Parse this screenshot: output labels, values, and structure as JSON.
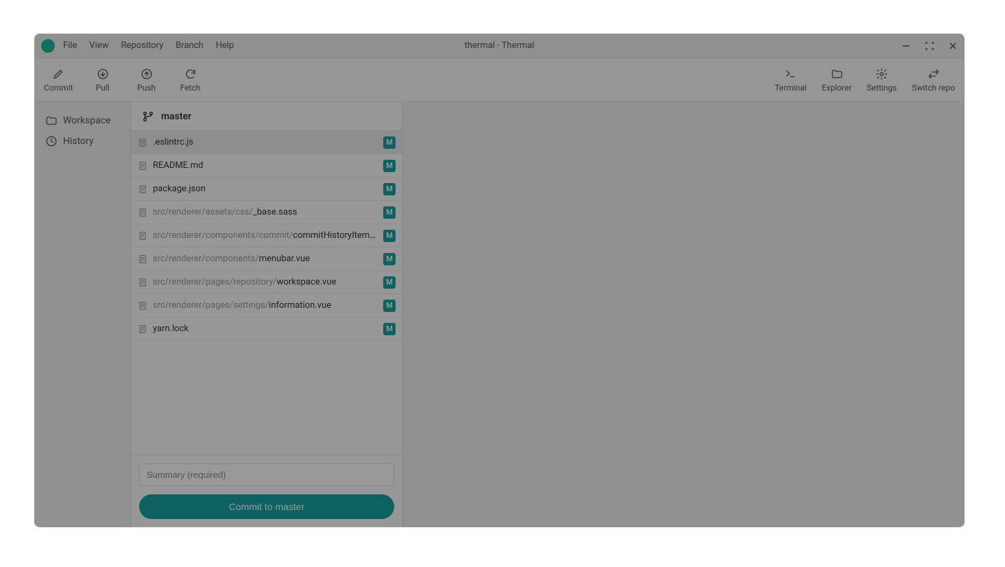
{
  "title": "thermal - Thermal",
  "menu": [
    "File",
    "View",
    "Repository",
    "Branch",
    "Help"
  ],
  "toolbar": {
    "left": [
      {
        "id": "commit",
        "label": "Commit",
        "icon": "pencil"
      },
      {
        "id": "pull",
        "label": "Pull",
        "icon": "arrow-down-circle"
      },
      {
        "id": "push",
        "label": "Push",
        "icon": "arrow-up-circle"
      },
      {
        "id": "fetch",
        "label": "Fetch",
        "icon": "refresh"
      }
    ],
    "right": [
      {
        "id": "terminal",
        "label": "Terminal",
        "icon": "terminal"
      },
      {
        "id": "explorer",
        "label": "Explorer",
        "icon": "folder"
      },
      {
        "id": "settings",
        "label": "Settings",
        "icon": "gear"
      },
      {
        "id": "switch",
        "label": "Switch repo",
        "icon": "swap"
      }
    ]
  },
  "sidebar": [
    {
      "id": "workspace",
      "label": "Workspace",
      "icon": "folder"
    },
    {
      "id": "history",
      "label": "History",
      "icon": "clock"
    }
  ],
  "branch": "master",
  "files": [
    {
      "dir": "",
      "name": ".eslintrc.js",
      "status": "M",
      "selected": true
    },
    {
      "dir": "",
      "name": "README.md",
      "status": "M"
    },
    {
      "dir": "",
      "name": "package.json",
      "status": "M"
    },
    {
      "dir": "src/renderer/assets/css/",
      "name": "_base.sass",
      "status": "M"
    },
    {
      "dir": "src/renderer/components/commit/",
      "name": "commitHistoryItem.vue",
      "status": "M"
    },
    {
      "dir": "src/renderer/components/",
      "name": "menubar.vue",
      "status": "M"
    },
    {
      "dir": "src/renderer/pages/repository/",
      "name": "workspace.vue",
      "status": "M"
    },
    {
      "dir": "src/renderer/pages/settings/",
      "name": "information.vue",
      "status": "M"
    },
    {
      "dir": "",
      "name": "yarn.lock",
      "status": "M"
    }
  ],
  "commitForm": {
    "placeholder": "Summary (required)",
    "button": "Commit to master"
  }
}
